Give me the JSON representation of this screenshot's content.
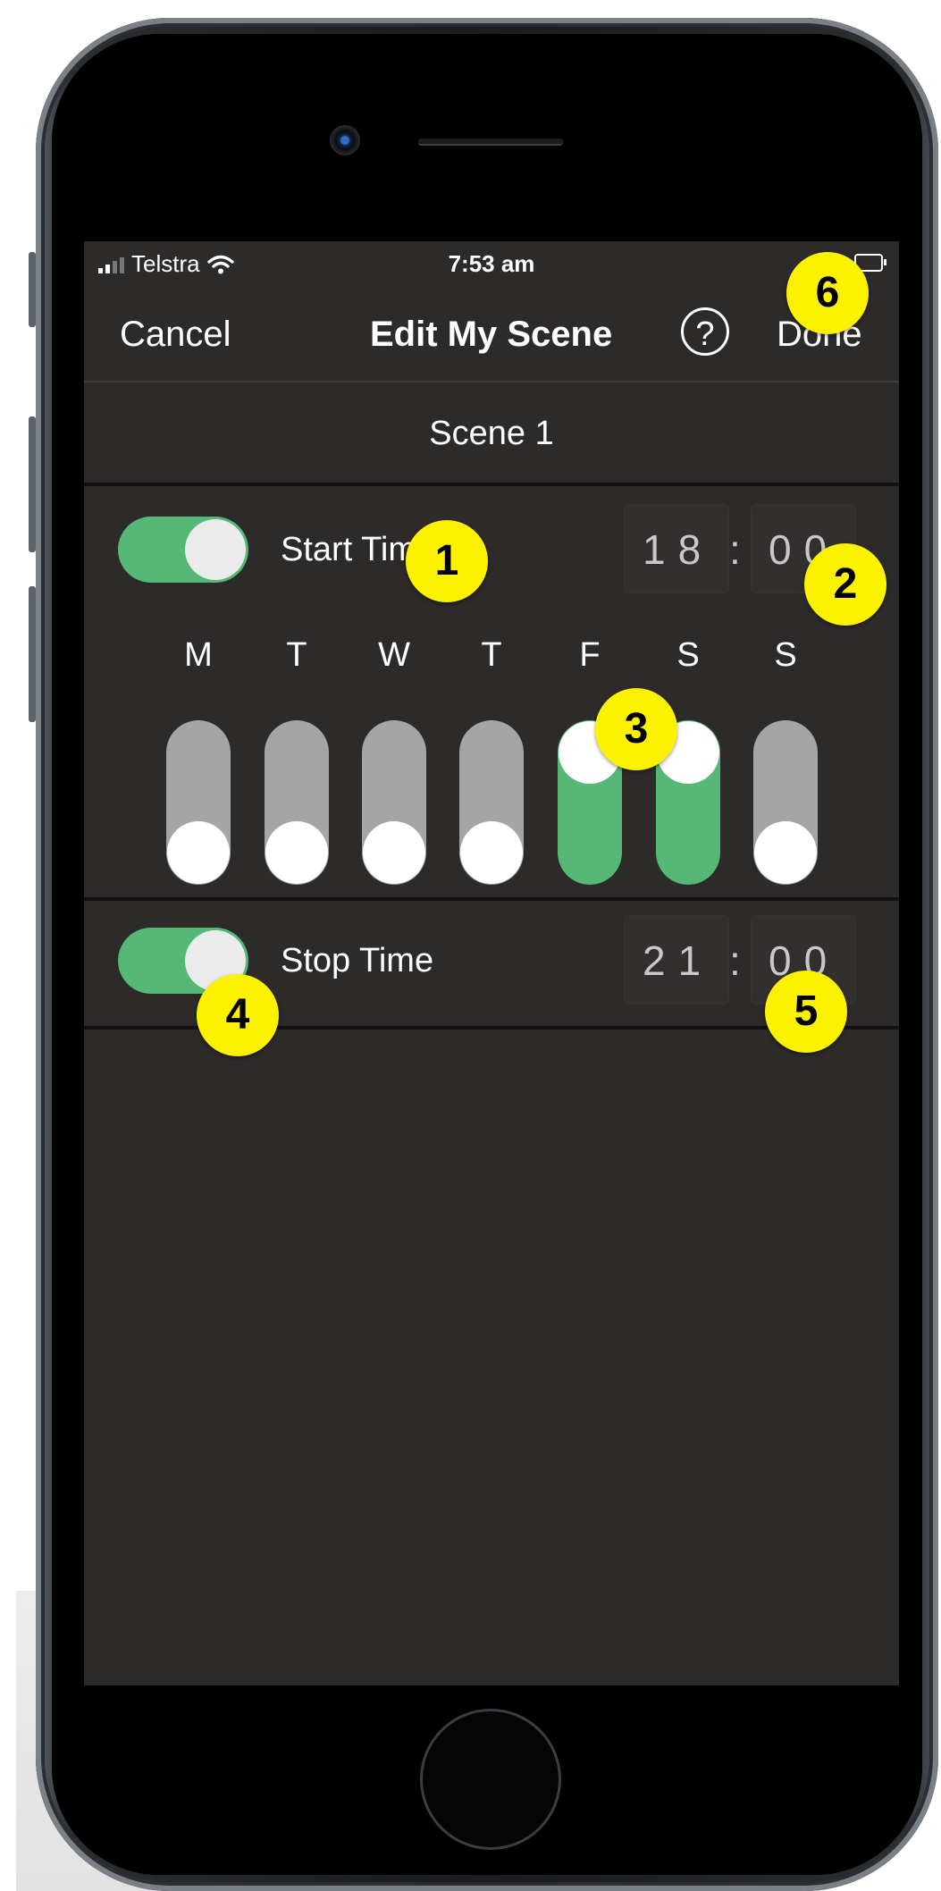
{
  "status_bar": {
    "carrier": "Telstra",
    "time": "7:53 am"
  },
  "nav": {
    "cancel_label": "Cancel",
    "title": "Edit My Scene",
    "help_label": "?",
    "done_label": "Done"
  },
  "scene": {
    "name": "Scene 1"
  },
  "start": {
    "enabled": true,
    "label": "Start Time",
    "hour": "18",
    "separator": ":",
    "minute": "00"
  },
  "days": [
    {
      "label": "M",
      "on": false
    },
    {
      "label": "T",
      "on": false
    },
    {
      "label": "W",
      "on": false
    },
    {
      "label": "T",
      "on": false
    },
    {
      "label": "F",
      "on": true
    },
    {
      "label": "S",
      "on": true
    },
    {
      "label": "S",
      "on": false
    }
  ],
  "stop": {
    "enabled": true,
    "label": "Stop Time",
    "hour": "21",
    "separator": ":",
    "minute": "00"
  },
  "callouts": [
    "1",
    "2",
    "3",
    "4",
    "5",
    "6"
  ],
  "colors": {
    "screen_bg": "#2d2a2a",
    "toggle_on": "#56b876",
    "toggle_off": "#a5a5a5",
    "callout": "#fcf200"
  }
}
